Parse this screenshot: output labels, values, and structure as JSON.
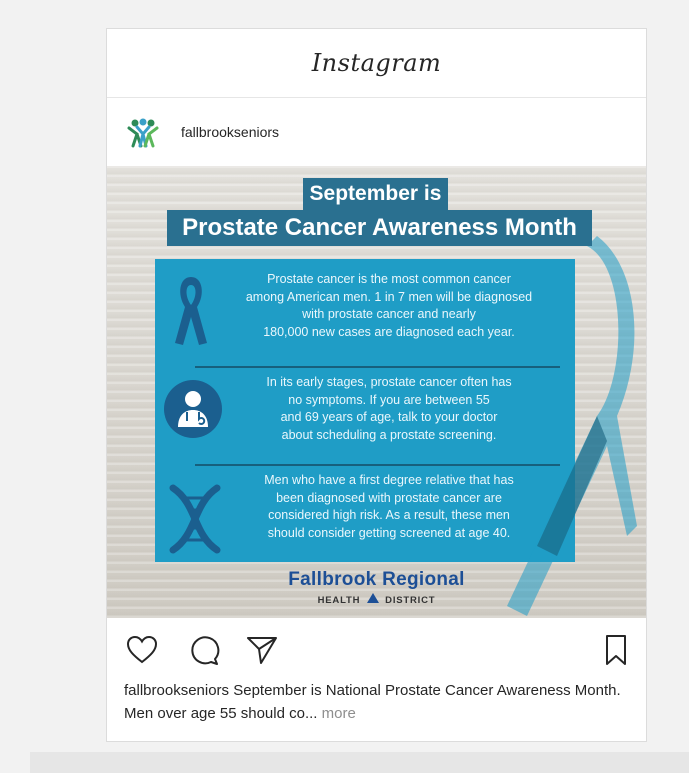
{
  "header": {
    "brand": "Instagram"
  },
  "post_author": {
    "username": "fallbrookseniors"
  },
  "graphic": {
    "title_line1": "September is",
    "title_line2": "Prostate Cancer Awareness Month",
    "sections": [
      {
        "icon": "awareness-ribbon-icon",
        "lines": [
          "Prostate cancer is the most common cancer",
          "among American men. 1 in 7 men will be diagnosed",
          "with prostate cancer and nearly",
          "180,000 new cases are diagnosed each year."
        ]
      },
      {
        "icon": "doctor-icon",
        "lines": [
          "In its early stages, prostate cancer often has",
          "no symptoms. If you are between 55",
          "and 69 years of age, talk to your doctor",
          "about scheduling a prostate screening."
        ]
      },
      {
        "icon": "dna-icon",
        "lines": [
          "Men who have a first degree relative that has",
          "been diagnosed with prostate cancer are",
          "considered high risk. As a result, these men",
          "should consider getting screened at age 40."
        ]
      }
    ],
    "org_name": "Fallbrook Regional",
    "org_sub_left": "HEALTH",
    "org_sub_right": "DISTRICT"
  },
  "caption": {
    "username": "fallbrookseniors",
    "text": " September is National Prostate Cancer Awareness Month. Men over age 55 should co...",
    "more": "more"
  },
  "colors": {
    "panel": "#1f9dc6",
    "title_bg": "#2a7090",
    "brand_blue": "#1d4f96"
  }
}
